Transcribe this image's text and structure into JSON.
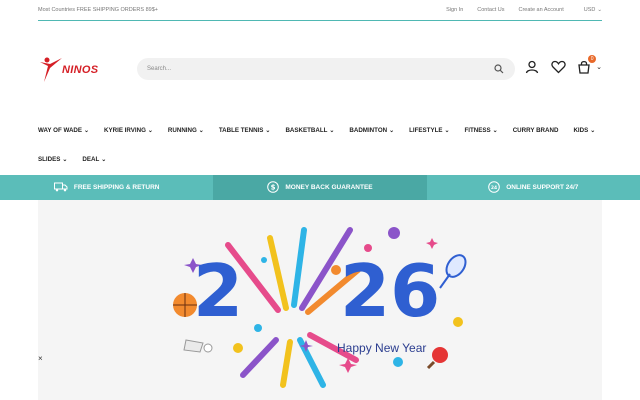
{
  "topbar": {
    "promo": "Most Countries FREE SHIPPING ORDERS 89$+",
    "sign_in": "Sign In",
    "contact": "Contact Us",
    "create_account": "Create an Account",
    "currency": "USD"
  },
  "header": {
    "logo_text": "NINOS",
    "search_placeholder": "Search...",
    "cart_count": "0"
  },
  "nav": {
    "row1": [
      {
        "label": "WAY OF WADE",
        "chevron": true
      },
      {
        "label": "KYRIE IRVING",
        "chevron": true
      },
      {
        "label": "RUNNING",
        "chevron": true
      },
      {
        "label": "TABLE TENNIS",
        "chevron": true
      },
      {
        "label": "BASKETBALL",
        "chevron": true
      },
      {
        "label": "BADMINTON",
        "chevron": true
      },
      {
        "label": "LIFESTYLE",
        "chevron": true
      },
      {
        "label": "FITNESS",
        "chevron": true
      },
      {
        "label": "CURRY BRAND",
        "chevron": false
      },
      {
        "label": "KIDS",
        "chevron": true
      }
    ],
    "row2": [
      {
        "label": "SLIDES",
        "chevron": true
      },
      {
        "label": "DEAL",
        "chevron": true
      }
    ]
  },
  "features": {
    "shipping": "FREE SHIPPING & RETURN",
    "money_back": "MONEY BACK GUARANTEE",
    "support": "ONLINE SUPPORT 24/7"
  },
  "banner": {
    "year_a": "2",
    "year_b": "26",
    "greeting": "Happy New Year",
    "close": "×"
  },
  "colors": {
    "teal": "#5bbdb9",
    "teal_dark": "#4aa8a4",
    "brand_red": "#d51f26",
    "year_blue": "#2f5fd1"
  }
}
